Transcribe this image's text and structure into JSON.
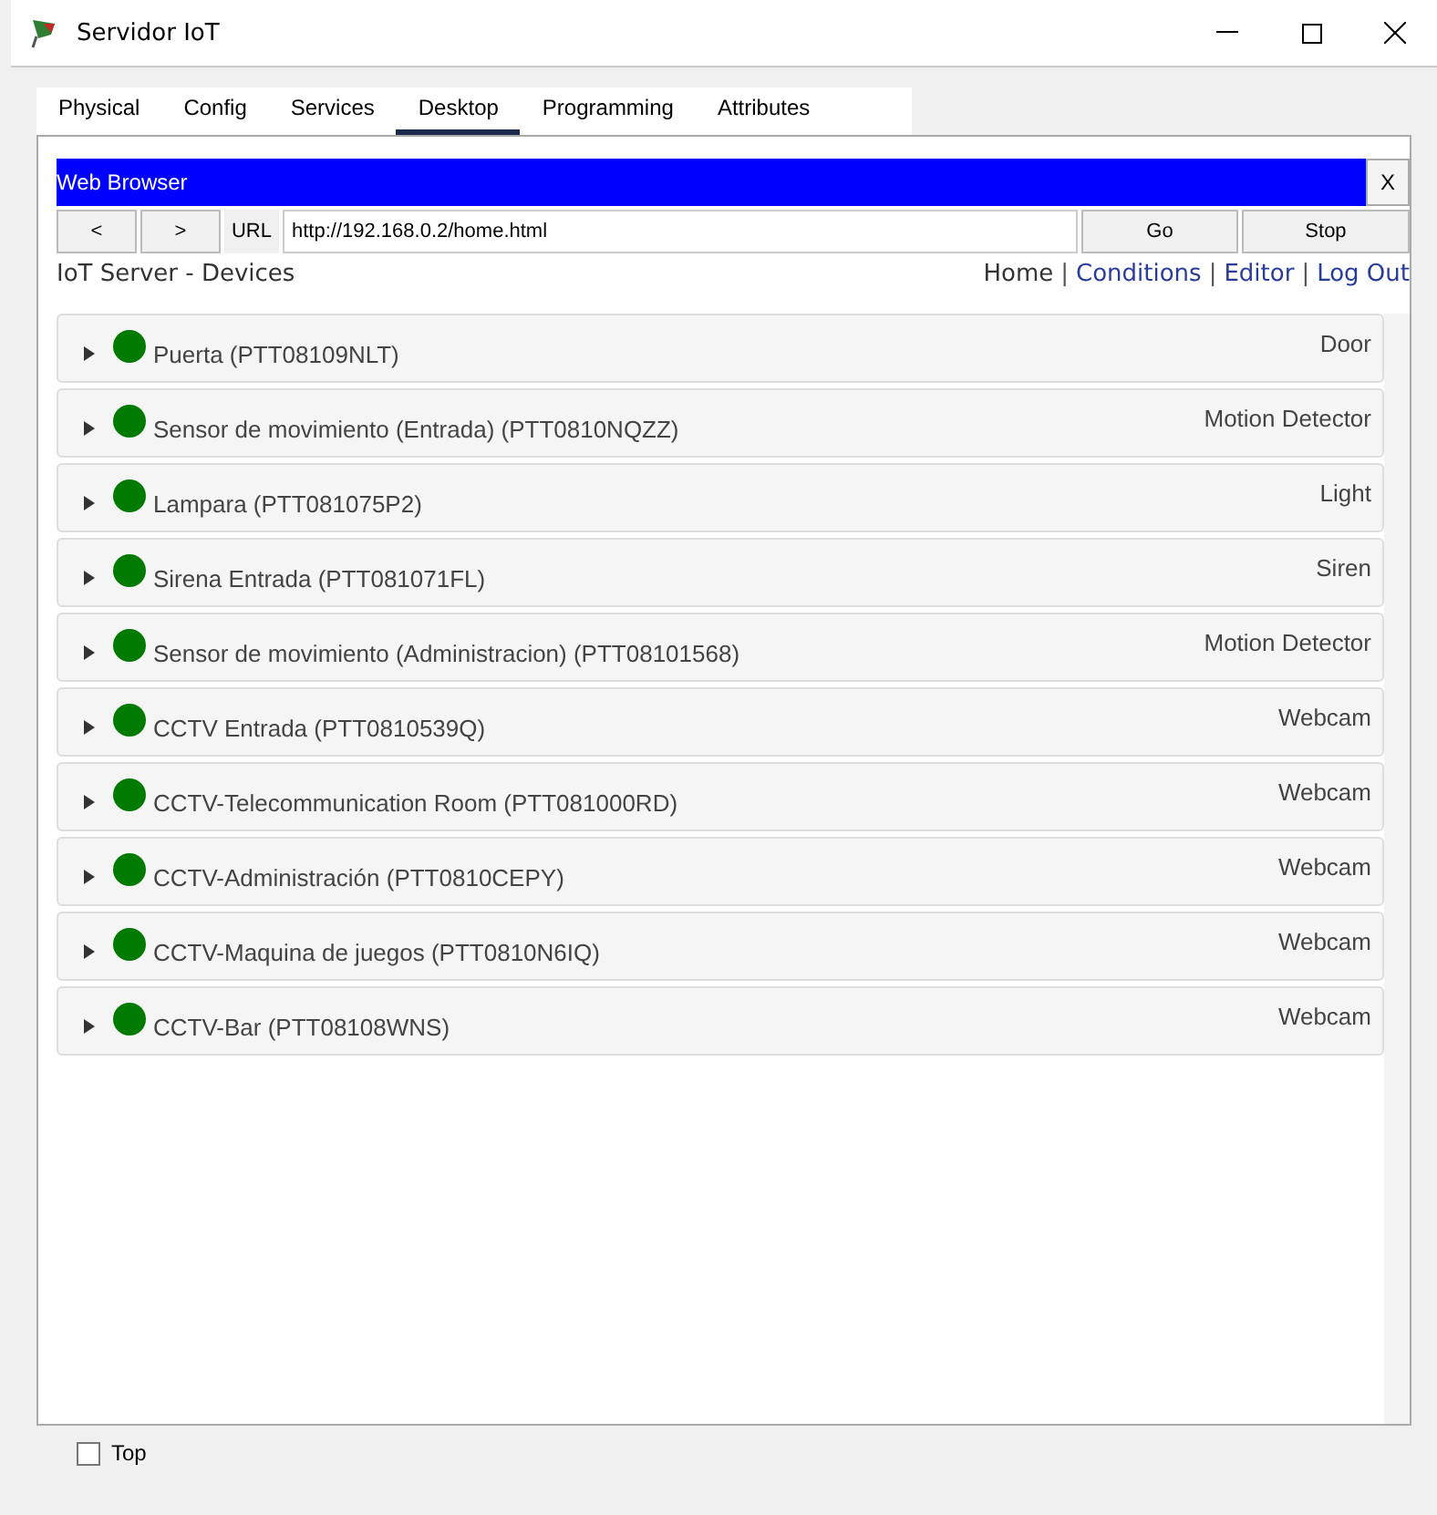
{
  "window": {
    "title": "Servidor IoT"
  },
  "tabs": [
    {
      "label": "Physical",
      "selected": false
    },
    {
      "label": "Config",
      "selected": false
    },
    {
      "label": "Services",
      "selected": false
    },
    {
      "label": "Desktop",
      "selected": true
    },
    {
      "label": "Programming",
      "selected": false
    },
    {
      "label": "Attributes",
      "selected": false
    }
  ],
  "browser": {
    "title": "Web Browser",
    "close": "X",
    "back": "<",
    "forward": ">",
    "url_label": "URL",
    "url": "http://192.168.0.2/home.html",
    "go": "Go",
    "stop": "Stop"
  },
  "page": {
    "heading": "IoT Server - Devices",
    "separator": "|",
    "nav": [
      {
        "label": "Home",
        "selected": true
      },
      {
        "label": "Conditions",
        "selected": false
      },
      {
        "label": "Editor",
        "selected": false
      },
      {
        "label": "Log Out",
        "selected": false
      }
    ],
    "devices": [
      {
        "name": "Puerta (PTT08109NLT)",
        "type": "Door",
        "expanded": false
      },
      {
        "name": "Sensor de movimiento (Entrada) (PTT0810NQZZ)",
        "type": "Motion Detector",
        "expanded": false
      },
      {
        "name": "Lampara (PTT081075P2)",
        "type": "Light",
        "expanded": false
      },
      {
        "name": "Sirena Entrada (PTT081071FL)",
        "type": "Siren",
        "expanded": false
      },
      {
        "name": "Sensor de movimiento (Administracion) (PTT08101568)",
        "type": "Motion Detector",
        "expanded": false
      },
      {
        "name": "CCTV Entrada (PTT0810539Q)",
        "type": "Webcam",
        "expanded": false
      },
      {
        "name": "CCTV-Telecommunication Room (PTT081000RD)",
        "type": "Webcam",
        "expanded": false
      },
      {
        "name": "CCTV-Administración (PTT0810CEPY)",
        "type": "Webcam",
        "expanded": false
      },
      {
        "name": "CCTV-Maquina de juegos (PTT0810N6IQ)",
        "type": "Webcam",
        "expanded": false
      },
      {
        "name": "CCTV-Bar (PTT08108WNS)",
        "type": "Webcam",
        "expanded": false
      }
    ]
  },
  "footer": {
    "label": "Top",
    "checked": false
  }
}
